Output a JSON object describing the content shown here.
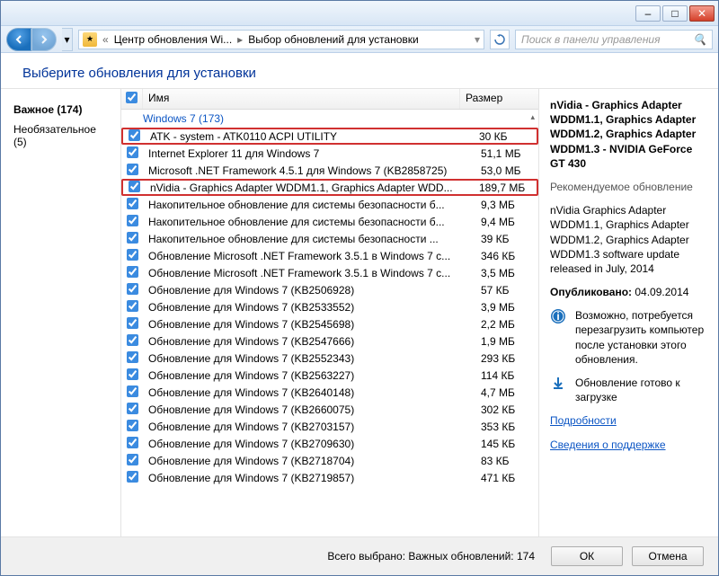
{
  "titlebar": {
    "min": "–",
    "max": "□",
    "close": "✕"
  },
  "navbar": {
    "icon_glyph": "★",
    "breadcrumb_1": "Центр обновления Wi...",
    "breadcrumb_2": "Выбор обновлений для установки",
    "search_placeholder": "Поиск в панели управления"
  },
  "heading": "Выберите обновления для установки",
  "leftnav": {
    "important": "Важное (174)",
    "optional": "Необязательное (5)"
  },
  "columns": {
    "name": "Имя",
    "size": "Размер"
  },
  "group_title": "Windows 7 (173)",
  "updates": [
    {
      "name": "ATK - system - ATK0110 ACPI UTILITY",
      "size": "30 КБ",
      "hl": true
    },
    {
      "name": "Internet Explorer 11 для Windows 7",
      "size": "51,1 МБ"
    },
    {
      "name": "Microsoft .NET Framework 4.5.1 для Windows 7 (KB2858725)",
      "size": "53,0 МБ"
    },
    {
      "name": "nVidia - Graphics Adapter WDDM1.1, Graphics Adapter WDD...",
      "size": "189,7 МБ",
      "hl": true
    },
    {
      "name": "Накопительное обновление для системы безопасности б...",
      "size": "9,3 МБ"
    },
    {
      "name": "Накопительное обновление для системы безопасности б...",
      "size": "9,4 МБ"
    },
    {
      "name": "Накопительное обновление для системы безопасности ...",
      "size": "39 КБ"
    },
    {
      "name": "Обновление Microsoft .NET Framework 3.5.1 в Windows 7 с...",
      "size": "346 КБ"
    },
    {
      "name": "Обновление Microsoft .NET Framework 3.5.1 в Windows 7 с...",
      "size": "3,5 МБ"
    },
    {
      "name": "Обновление для Windows 7 (KB2506928)",
      "size": "57 КБ"
    },
    {
      "name": "Обновление для Windows 7 (KB2533552)",
      "size": "3,9 МБ"
    },
    {
      "name": "Обновление для Windows 7 (KB2545698)",
      "size": "2,2 МБ"
    },
    {
      "name": "Обновление для Windows 7 (KB2547666)",
      "size": "1,9 МБ"
    },
    {
      "name": "Обновление для Windows 7 (KB2552343)",
      "size": "293 КБ"
    },
    {
      "name": "Обновление для Windows 7 (KB2563227)",
      "size": "114 КБ"
    },
    {
      "name": "Обновление для Windows 7 (KB2640148)",
      "size": "4,7 МБ"
    },
    {
      "name": "Обновление для Windows 7 (KB2660075)",
      "size": "302 КБ"
    },
    {
      "name": "Обновление для Windows 7 (KB2703157)",
      "size": "353 КБ"
    },
    {
      "name": "Обновление для Windows 7 (KB2709630)",
      "size": "145 КБ"
    },
    {
      "name": "Обновление для Windows 7 (KB2718704)",
      "size": "83 КБ"
    },
    {
      "name": "Обновление для Windows 7 (KB2719857)",
      "size": "471 КБ"
    }
  ],
  "details": {
    "title": "nVidia - Graphics Adapter WDDM1.1, Graphics Adapter WDDM1.2, Graphics Adapter WDDM1.3 - NVIDIA GeForce GT 430",
    "recommended": "Рекомендуемое обновление",
    "desc": "nVidia Graphics Adapter WDDM1.1, Graphics Adapter WDDM1.2, Graphics Adapter WDDM1.3 software update released in July, 2014",
    "published_label": "Опубликовано:",
    "published_date": "04.09.2014",
    "warning": "Возможно, потребуется перезагрузить компьютер после установки этого обновления.",
    "ready": "Обновление готово к загрузке",
    "link_details": "Подробности",
    "link_support": "Сведения о поддержке"
  },
  "footer": {
    "status": "Всего выбрано: Важных обновлений: 174",
    "ok": "ОК",
    "cancel": "Отмена"
  }
}
